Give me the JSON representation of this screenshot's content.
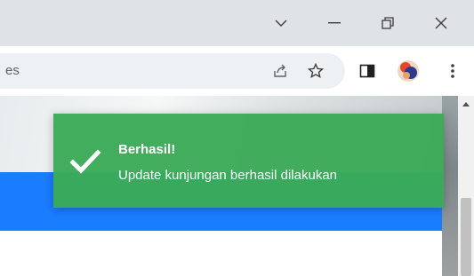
{
  "window": {
    "controls": [
      {
        "name": "tab-search-icon"
      },
      {
        "name": "minimize-icon"
      },
      {
        "name": "restore-icon"
      },
      {
        "name": "close-icon"
      }
    ]
  },
  "toolbar": {
    "address_text": "es",
    "icons": [
      "share-icon",
      "bookmark-star-icon",
      "side-panel-icon",
      "profile-avatar",
      "menu-kebab-icon"
    ]
  },
  "toast": {
    "title": "Berhasil!",
    "message": "Update kunjungan berhasil dilakukan",
    "color": "#3aab56",
    "icon": "checkmark-icon"
  },
  "colors": {
    "titlebar": "#dfe3e8",
    "accent_blue": "#1a7cff"
  }
}
